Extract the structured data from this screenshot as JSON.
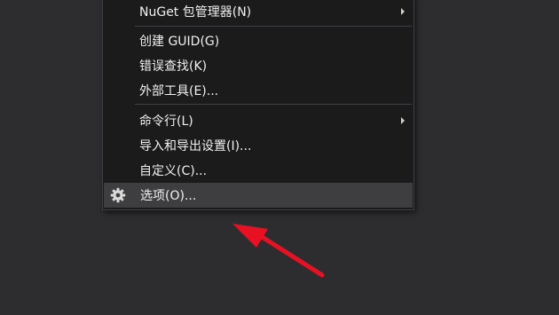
{
  "menu": {
    "items": [
      {
        "label": "NuGet 包管理器(N)"
      },
      {
        "label": "创建 GUID(G)"
      },
      {
        "label": "错误查找(K)"
      },
      {
        "label": "外部工具(E)..."
      },
      {
        "label": "命令行(L)"
      },
      {
        "label": "导入和导出设置(I)..."
      },
      {
        "label": "自定义(C)..."
      },
      {
        "label": "选项(O)..."
      }
    ]
  },
  "icons": {
    "submenu_arrow": "chevron-right-icon",
    "options_icon": "gear-icon"
  },
  "colors": {
    "background": "#2d2d30",
    "menu_background": "#1b1b1c",
    "highlight": "#3e3e40",
    "text": "#f1f1f1",
    "annotation_arrow": "#e81123"
  }
}
